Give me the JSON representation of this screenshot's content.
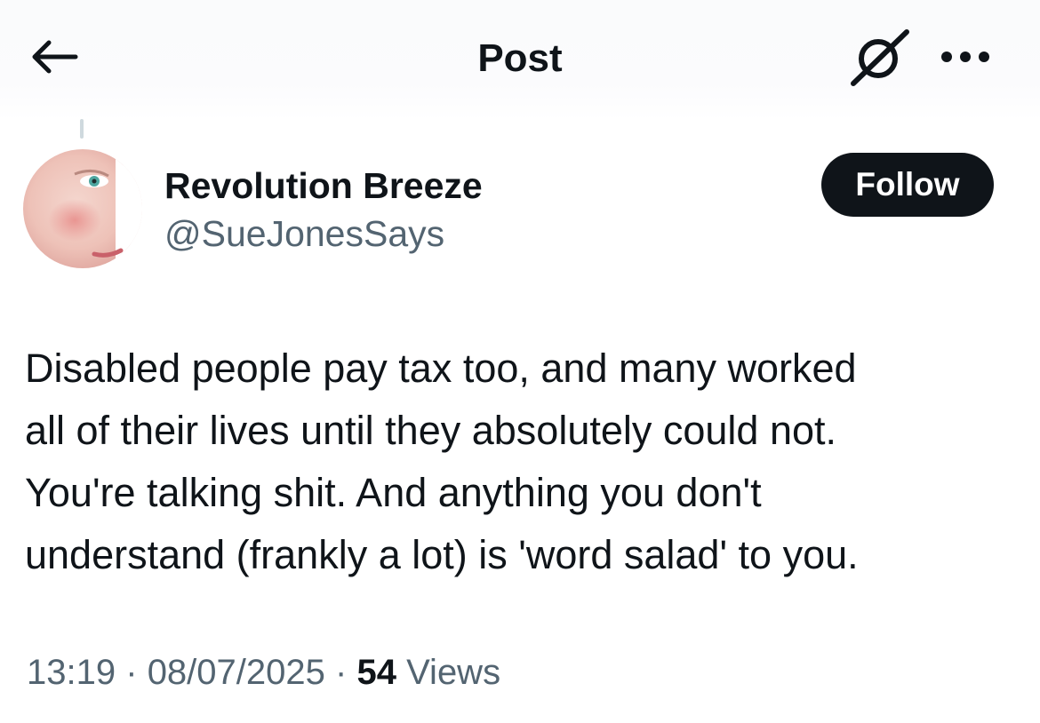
{
  "header": {
    "title": "Post",
    "back_icon": "arrow-left-icon",
    "grok_icon": "grok-icon",
    "more_icon": "more-dots-icon"
  },
  "author": {
    "display_name": "Revolution Breeze",
    "handle": "@SueJonesSays",
    "avatar_icon": "avatar-photo"
  },
  "actions": {
    "follow_label": "Follow"
  },
  "post": {
    "text": "Disabled people pay tax too, and many worked\nall of their lives until they absolutely could not.\nYou're talking shit. And anything you don't\nunderstand (frankly a lot) is 'word salad' to you.",
    "time": "13:19",
    "date": "08/07/2025",
    "separator": "·",
    "views_count": "54",
    "views_label": "Views"
  },
  "colors": {
    "text_primary": "#0f1419",
    "text_secondary": "#536471",
    "button_bg": "#0f1419",
    "button_text": "#ffffff",
    "thread_line": "#cfd9de"
  }
}
